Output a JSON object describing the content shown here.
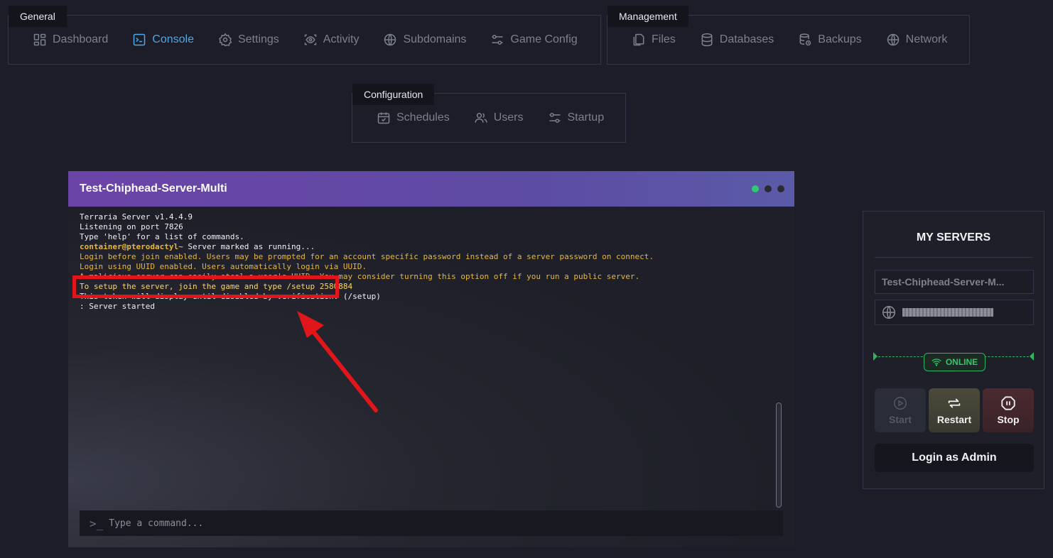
{
  "nav": {
    "general": {
      "legend": "General",
      "items": [
        {
          "label": "Dashboard",
          "icon": "dashboard-icon"
        },
        {
          "label": "Console",
          "icon": "terminal-icon",
          "active": true
        },
        {
          "label": "Settings",
          "icon": "gear-icon"
        },
        {
          "label": "Activity",
          "icon": "eye-icon"
        },
        {
          "label": "Subdomains",
          "icon": "globe-icon"
        },
        {
          "label": "Game Config",
          "icon": "sliders-icon"
        }
      ]
    },
    "management": {
      "legend": "Management",
      "items": [
        {
          "label": "Files",
          "icon": "files-icon"
        },
        {
          "label": "Databases",
          "icon": "database-icon"
        },
        {
          "label": "Backups",
          "icon": "backup-icon"
        },
        {
          "label": "Network",
          "icon": "globe-icon"
        }
      ]
    },
    "configuration": {
      "legend": "Configuration",
      "items": [
        {
          "label": "Schedules",
          "icon": "calendar-icon"
        },
        {
          "label": "Users",
          "icon": "users-icon"
        },
        {
          "label": "Startup",
          "icon": "sliders-icon"
        }
      ]
    }
  },
  "console": {
    "title": "Test-Chiphead-Server-Multi",
    "lines": [
      {
        "text": "Terraria Server v1.4.4.9",
        "style": "white"
      },
      {
        "text": "Listening on port 7826",
        "style": "white"
      },
      {
        "text": "Type 'help' for a list of commands.",
        "style": "white"
      },
      {
        "prompt": "container@pterodactyl~",
        "text": " Server marked as running...",
        "style": "white"
      },
      {
        "text": "Login before join enabled. Users may be prompted for an account specific password instead of a server password on connect.",
        "style": "yellow"
      },
      {
        "text": "Login using UUID enabled. Users automatically login via UUID.",
        "style": "yellow"
      },
      {
        "text": "A malicious server can easily steal a user's UUID. You may consider turning this option off if you run a public server.",
        "style": "yellow"
      },
      {
        "text": "To setup the server, join the game and type /setup 2580884",
        "style": "bright"
      },
      {
        "text": "This token will display until disabled by verification. (/setup)",
        "style": "white"
      },
      {
        "text": ": Server started",
        "style": "white"
      }
    ],
    "command_placeholder": "Type a command...",
    "prompt_symbol": ">_"
  },
  "servers": {
    "title": "MY SERVERS",
    "server_name": "Test-Chiphead-Server-M...",
    "status": "ONLINE",
    "status_color": "#2fb45f",
    "buttons": {
      "start": "Start",
      "restart": "Restart",
      "stop": "Stop",
      "login": "Login as Admin"
    }
  },
  "annotation_color": "#e0161b"
}
